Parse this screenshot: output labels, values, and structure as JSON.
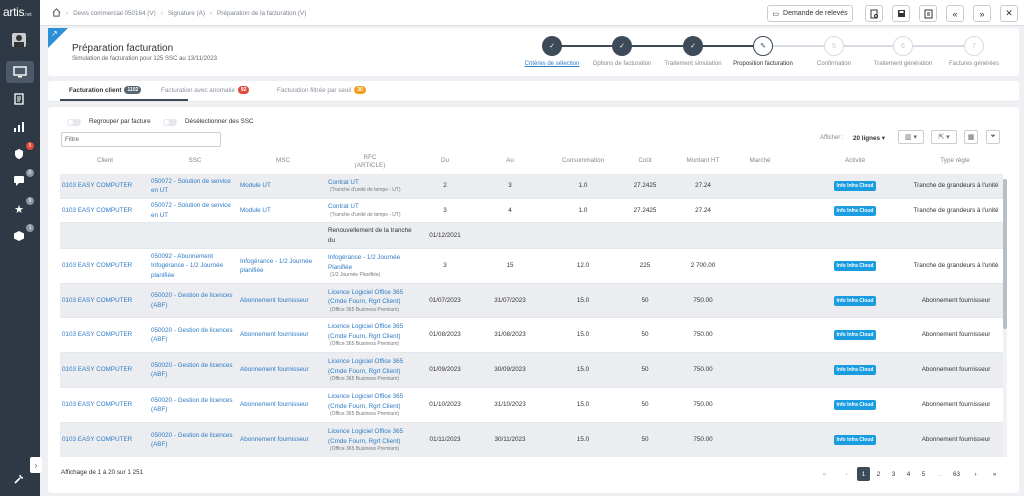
{
  "app": {
    "logo": "artis",
    "logo_suffix": ".net"
  },
  "breadcrumb": [
    "Devis commercial 050164 (V)",
    "Signature (A)",
    "Préparation de la facturation (V)"
  ],
  "sidebar": {
    "badges": [
      "5",
      "0",
      "9",
      "1"
    ]
  },
  "toolbar": {
    "demande_label": "Demande de relevés"
  },
  "header": {
    "title": "Préparation facturation",
    "subtitle": "Simulation de facturation pour 125 SSC au 13/11/2023"
  },
  "steps": [
    {
      "label": "Critères de sélection",
      "status": "done",
      "num": "1"
    },
    {
      "label": "Options de facturation",
      "status": "done",
      "num": "2"
    },
    {
      "label": "Traitement simulation",
      "status": "done",
      "num": "3"
    },
    {
      "label": "Proposition facturation",
      "status": "current",
      "num": "4"
    },
    {
      "label": "Confirmation",
      "status": "todo",
      "num": "5"
    },
    {
      "label": "Traitement génération",
      "status": "todo",
      "num": "6"
    },
    {
      "label": "Factures générées",
      "status": "todo",
      "num": "7"
    }
  ],
  "tabs": [
    {
      "label": "Facturation client",
      "badge": "1102",
      "badge_color": "#5b6673"
    },
    {
      "label": "Facturation avec anomalie",
      "badge": "92",
      "badge_color": "#e04a3b"
    },
    {
      "label": "Facturation filtrée par seuil",
      "badge": "30",
      "badge_color": "#f0a020"
    }
  ],
  "controls": {
    "regrouper": "Regrouper par facture",
    "deselect": "Désélectionner des SSC",
    "filter_placeholder": "Filtre",
    "show_label": "Afficher :",
    "show_value": "20 lignes"
  },
  "columns": {
    "client": "Client",
    "ssc": "SSC",
    "msc": "MSC",
    "rfc": "RFC",
    "rfc_sub": "(ARTICLE)",
    "du": "Du",
    "au": "Au",
    "conso": "Consommation",
    "cout": "Coût",
    "montant": "Montant HT",
    "marche": "Marché",
    "activite": "Activité",
    "type": "Type règle"
  },
  "rows": [
    {
      "client": "0103 EASY COMPUTER",
      "ssc": "050072 - Solution de service en UT",
      "msc": "Module UT",
      "rfc": "Contrat UT",
      "rfc_sub": "(Tranche d'unité de temps - UT)",
      "du": "2",
      "au": "3",
      "conso": "1.0",
      "cout": "27.2425",
      "montant": "27.24",
      "activite": "Info Infra Cloud",
      "type": "Tranche de grandeurs à l'unité"
    },
    {
      "client": "0103 EASY COMPUTER",
      "ssc": "050072 - Solution de service en UT",
      "msc": "Module UT",
      "rfc": "Contrat UT",
      "rfc_sub": "(Tranche d'unité de temps - UT)",
      "du": "3",
      "au": "4",
      "conso": "1.0",
      "cout": "27.2425",
      "montant": "27.24",
      "activite": "Info Infra Cloud",
      "type": "Tranche de grandeurs à l'unité"
    },
    {
      "client": "",
      "ssc": "",
      "msc": "",
      "rfc": "Renouvellement de la tranche du",
      "rfc_sub": "",
      "du": "01/12/2021",
      "au": "",
      "conso": "",
      "cout": "",
      "montant": "",
      "activite": "",
      "type": ""
    },
    {
      "client": "0103 EASY COMPUTER",
      "ssc": "050092 - Abonnement Infogérance - 1/2 Journée planifiée",
      "msc": "Infogérance - 1/2 Journée planifiée",
      "rfc": "Infogérance - 1/2 Journée Planifiée",
      "rfc_sub": "(1/2 Journée Planifiée)",
      "du": "3",
      "au": "15",
      "conso": "12.0",
      "cout": "225",
      "montant": "2 700.00",
      "activite": "Info Infra Cloud",
      "type": "Tranche de grandeurs à l'unité"
    },
    {
      "client": "0103 EASY COMPUTER",
      "ssc": "050020 - Gestion de licences (ABF)",
      "msc": "Abonnement fournisseur",
      "rfc": "Licence Logiciel Office 365 (Cmde Fourn, Rgrt Client)",
      "rfc_sub": "(Office 365 Business Premium)",
      "du": "01/07/2023",
      "au": "31/07/2023",
      "conso": "15.0",
      "cout": "50",
      "montant": "750.00",
      "activite": "Info Infra Cloud",
      "type": "Abonnement fournisseur"
    },
    {
      "client": "0103 EASY COMPUTER",
      "ssc": "050020 - Gestion de licences (ABF)",
      "msc": "Abonnement fournisseur",
      "rfc": "Licence Logiciel Office 365 (Cmde Fourn, Rgrt Client)",
      "rfc_sub": "(Office 365 Business Premium)",
      "du": "01/08/2023",
      "au": "31/08/2023",
      "conso": "15.0",
      "cout": "50",
      "montant": "750.00",
      "activite": "Info Infra Cloud",
      "type": "Abonnement fournisseur"
    },
    {
      "client": "0103 EASY COMPUTER",
      "ssc": "050020 - Gestion de licences (ABF)",
      "msc": "Abonnement fournisseur",
      "rfc": "Licence Logiciel Office 365 (Cmde Fourn, Rgrt Client)",
      "rfc_sub": "(Office 365 Business Premium)",
      "du": "01/09/2023",
      "au": "30/09/2023",
      "conso": "15.0",
      "cout": "50",
      "montant": "750.00",
      "activite": "Info Infra Cloud",
      "type": "Abonnement fournisseur"
    },
    {
      "client": "0103 EASY COMPUTER",
      "ssc": "050020 - Gestion de licences (ABF)",
      "msc": "Abonnement fournisseur",
      "rfc": "Licence Logiciel Office 365 (Cmde Fourn, Rgrt Client)",
      "rfc_sub": "(Office 365 Business Premium)",
      "du": "01/10/2023",
      "au": "31/10/2023",
      "conso": "15.0",
      "cout": "50",
      "montant": "750.00",
      "activite": "Info Infra Cloud",
      "type": "Abonnement fournisseur"
    },
    {
      "client": "0103 EASY COMPUTER",
      "ssc": "050020 - Gestion de licences (ABF)",
      "msc": "Abonnement fournisseur",
      "rfc": "Licence Logiciel Office 365 (Cmde Fourn, Rgrt Client)",
      "rfc_sub": "(Office 365 Business Premium)",
      "du": "01/11/2023",
      "au": "30/11/2023",
      "conso": "15.0",
      "cout": "50",
      "montant": "750.00",
      "activite": "Info Infra Cloud",
      "type": "Abonnement fournisseur"
    }
  ],
  "footer": {
    "info": "Affichage de 1 à 20 sur 1 251"
  },
  "pagination": [
    "«",
    "‹",
    "1",
    "2",
    "3",
    "4",
    "5",
    "...",
    "63",
    "›",
    "»"
  ]
}
